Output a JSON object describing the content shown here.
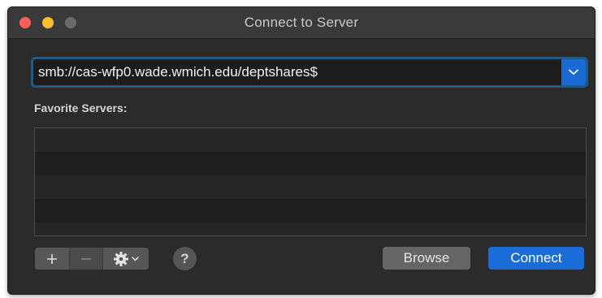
{
  "window": {
    "title": "Connect to Server"
  },
  "address": {
    "value": "smb://cas-wfp0.wade.wmich.edu/deptshares$"
  },
  "favorites": {
    "label": "Favorite Servers:",
    "items": []
  },
  "toolbar": {
    "add_label": "+",
    "remove_label": "−",
    "help_label": "?"
  },
  "actions": {
    "browse_label": "Browse",
    "connect_label": "Connect"
  },
  "icons": {
    "dropdown": "chevron-down-icon",
    "action_menu": "gear-icon"
  },
  "colors": {
    "accent": "#1a6cd8",
    "close": "#ff5f57",
    "minimize": "#febc2e"
  }
}
